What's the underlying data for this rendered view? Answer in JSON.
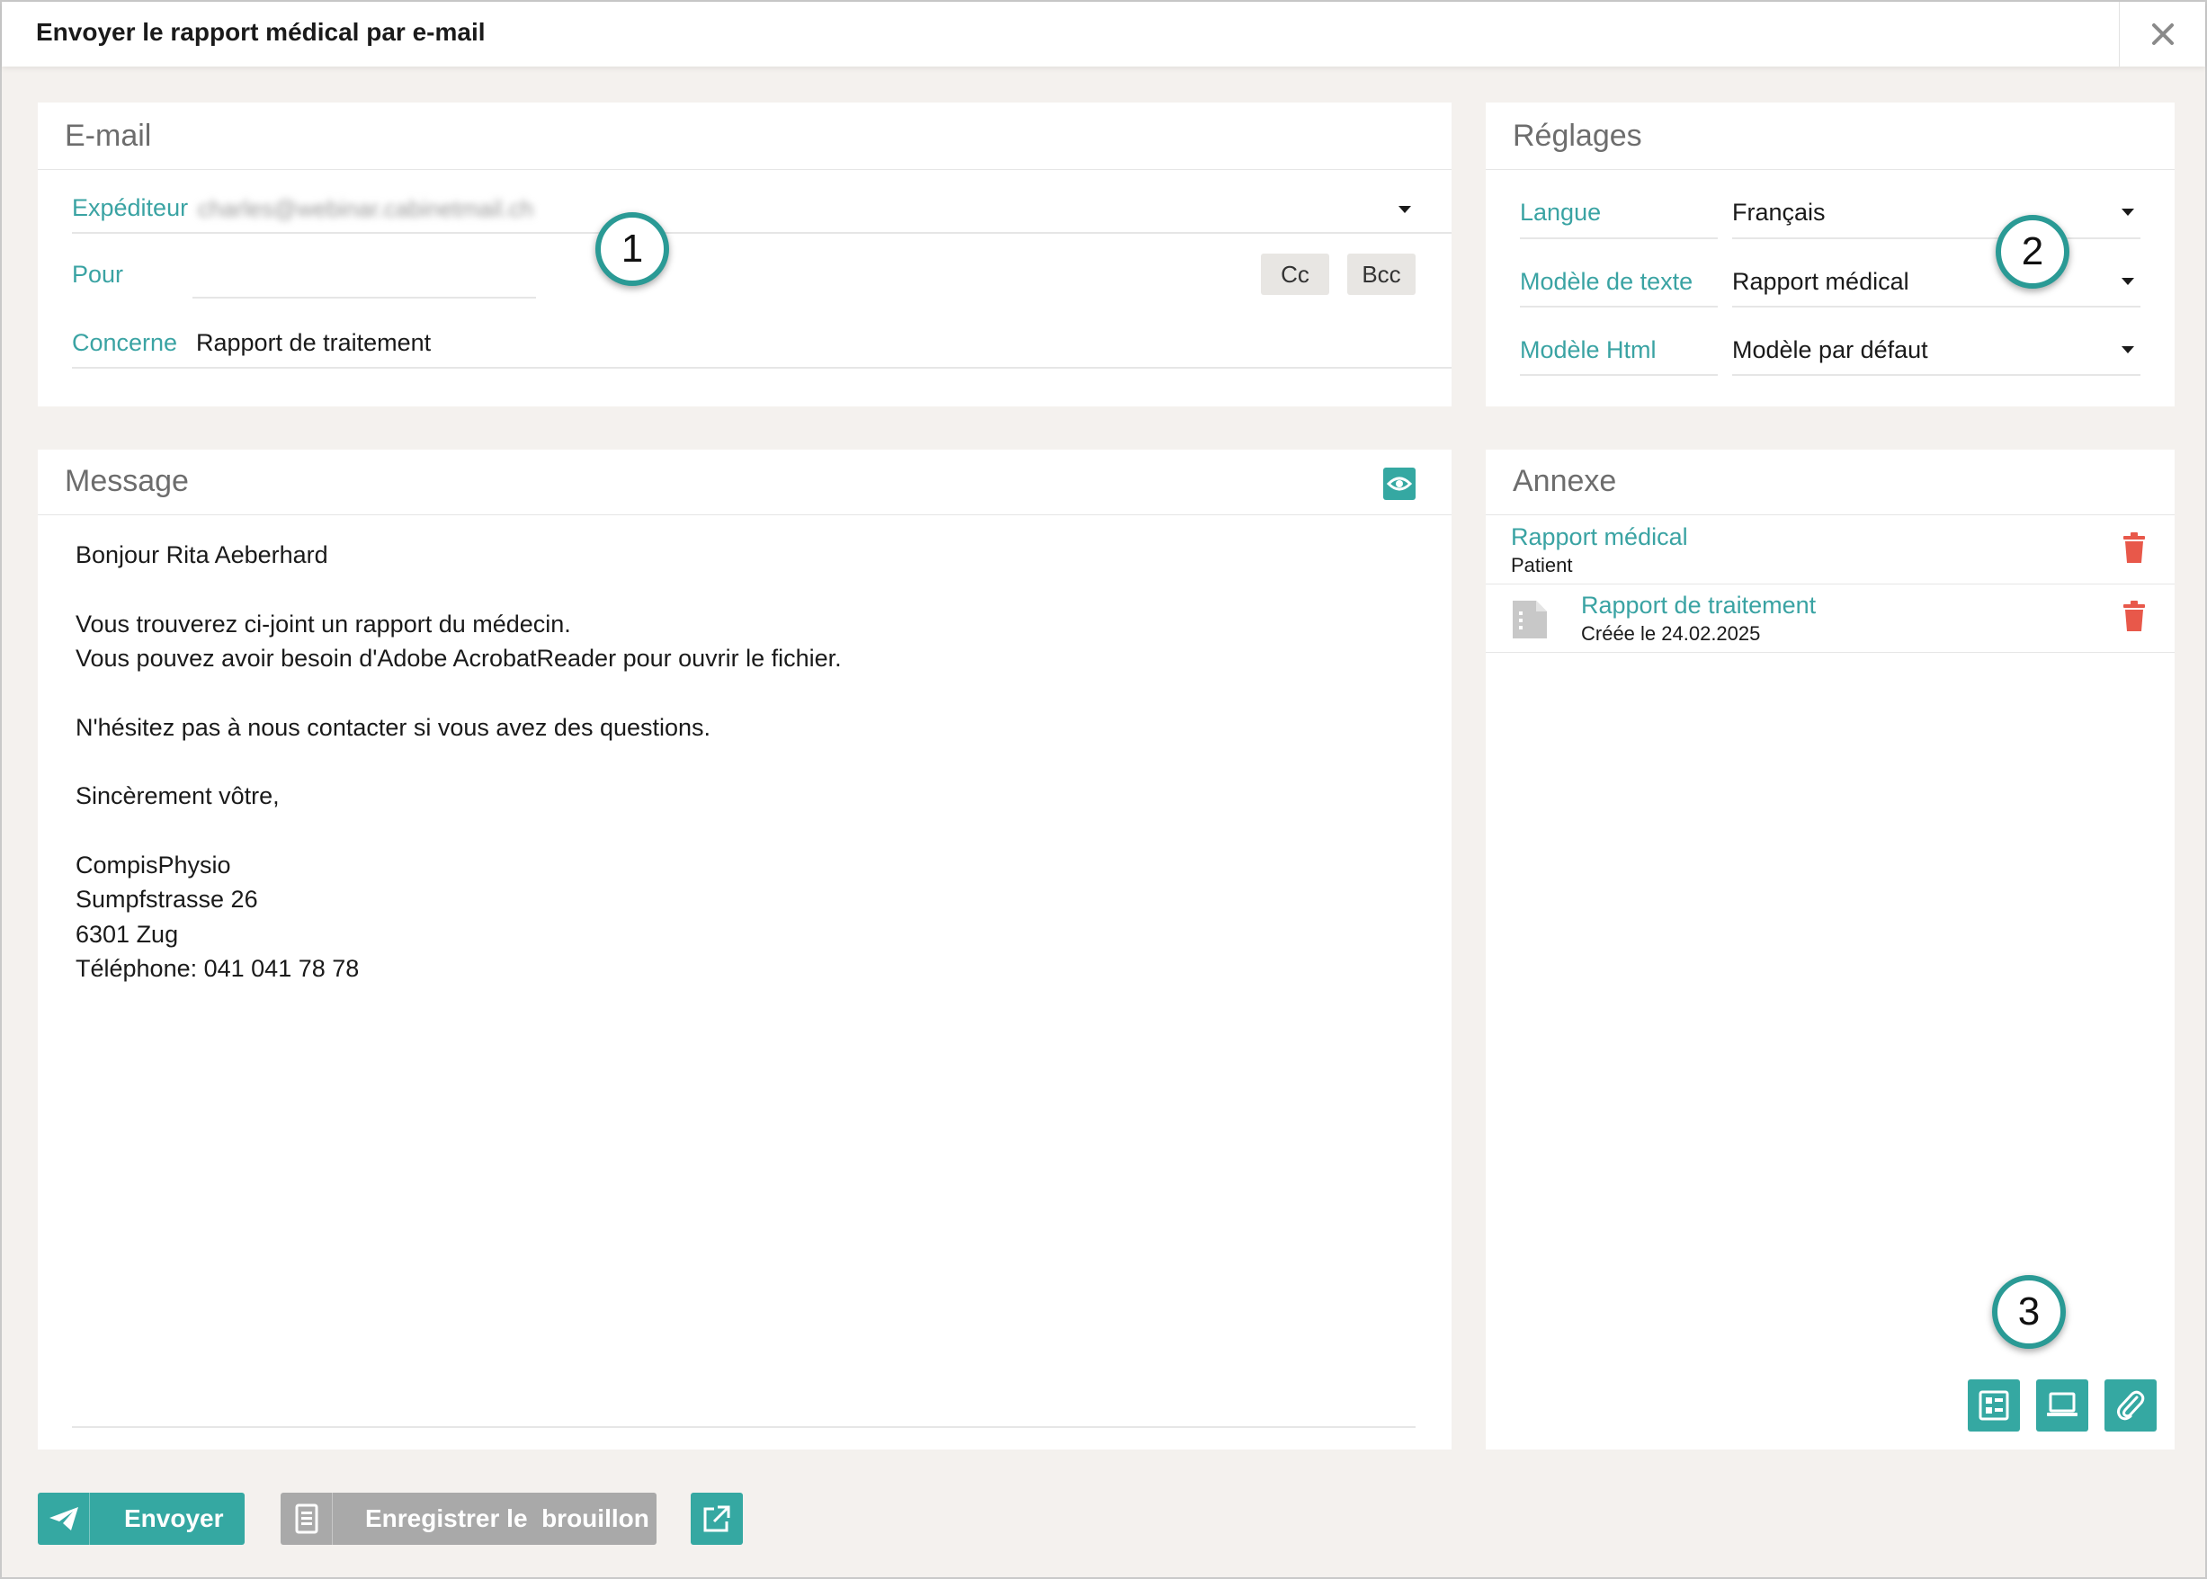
{
  "window": {
    "title": "Envoyer le rapport médical par e-mail",
    "close_icon": "close-icon"
  },
  "email": {
    "section_title": "E-mail",
    "sender_label": "Expéditeur",
    "sender_value": "charles@webinar.cabinetmail.ch",
    "to_label": "Pour",
    "to_value": "",
    "cc_label": "Cc",
    "bcc_label": "Bcc",
    "subject_label": "Concerne",
    "subject_value": "Rapport de traitement"
  },
  "settings": {
    "section_title": "Réglages",
    "language_label": "Langue",
    "language_value": "Français",
    "text_template_label": "Modèle de texte",
    "text_template_value": "Rapport médical",
    "html_template_label": "Modèle Html",
    "html_template_value": "Modèle par défaut"
  },
  "message": {
    "section_title": "Message",
    "preview_icon": "eye-icon",
    "lines": [
      "Bonjour Rita Aeberhard",
      "",
      "Vous trouverez ci-joint un rapport du médecin.",
      "Vous pouvez avoir besoin d'Adobe AcrobatReader pour ouvrir le fichier.",
      "",
      "N'hésitez pas à nous contacter si vous avez des questions.",
      "",
      "Sincèrement vôtre,",
      "",
      "CompisPhysio",
      "Sumpfstrasse 26",
      "6301 Zug",
      "Téléphone: 041 041 78 78"
    ]
  },
  "attachments": {
    "section_title": "Annexe",
    "items": [
      {
        "title": "Rapport médical",
        "subtitle": "Patient",
        "icon": ""
      },
      {
        "title": "Rapport de traitement",
        "subtitle": "Créée le 24.02.2025",
        "icon": "document-icon"
      }
    ],
    "actions": [
      {
        "icon": "form-list-icon"
      },
      {
        "icon": "laptop-icon"
      },
      {
        "icon": "paperclip-icon"
      }
    ]
  },
  "callouts": [
    "1",
    "2",
    "3"
  ],
  "footer": {
    "send_label": "Envoyer",
    "draft_label": "Enregistrer le  brouillon",
    "external_icon": "external-link-icon"
  },
  "colors": {
    "accent": "#35a8a2",
    "delete": "#e8584a",
    "background": "#f4f1ee",
    "disabled_button": "#a9a9a9"
  }
}
